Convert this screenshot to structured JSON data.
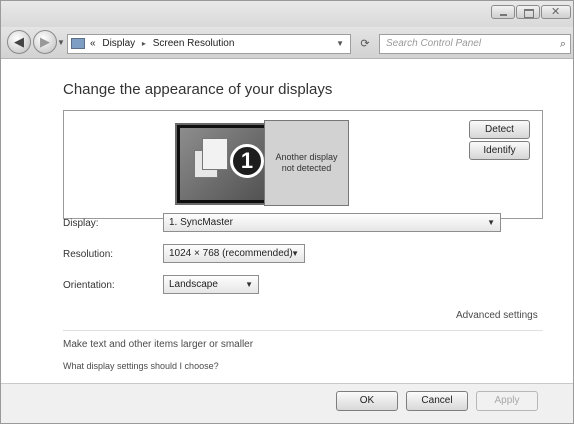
{
  "navbar": {
    "address": {
      "overflow": "«",
      "segments": [
        "Display",
        "Screen Resolution"
      ],
      "separator": "▸"
    },
    "search": {
      "placeholder": "Search Control Panel"
    }
  },
  "main": {
    "title": "Change the appearance of your displays",
    "preview": {
      "monitor_number": "1",
      "second_monitor_text": "Another display not detected"
    },
    "buttons": {
      "detect": "Detect",
      "identify": "Identify"
    },
    "fields": {
      "display": {
        "label": "Display:",
        "value": "1. SyncMaster"
      },
      "resolution": {
        "label": "Resolution:",
        "value": "1024 × 768 (recommended)"
      },
      "orientation": {
        "label": "Orientation:",
        "value": "Landscape"
      }
    },
    "advanced_link": "Advanced settings",
    "links": [
      "Make text and other items larger or smaller",
      "What display settings should I choose?"
    ]
  },
  "footer": {
    "ok": "OK",
    "cancel": "Cancel",
    "apply": "Apply"
  },
  "icons": {
    "back": "back-arrow-icon",
    "forward": "forward-arrow-icon",
    "refresh": "refresh-icon",
    "search": "search-icon",
    "control_panel": "control-panel-icon"
  }
}
